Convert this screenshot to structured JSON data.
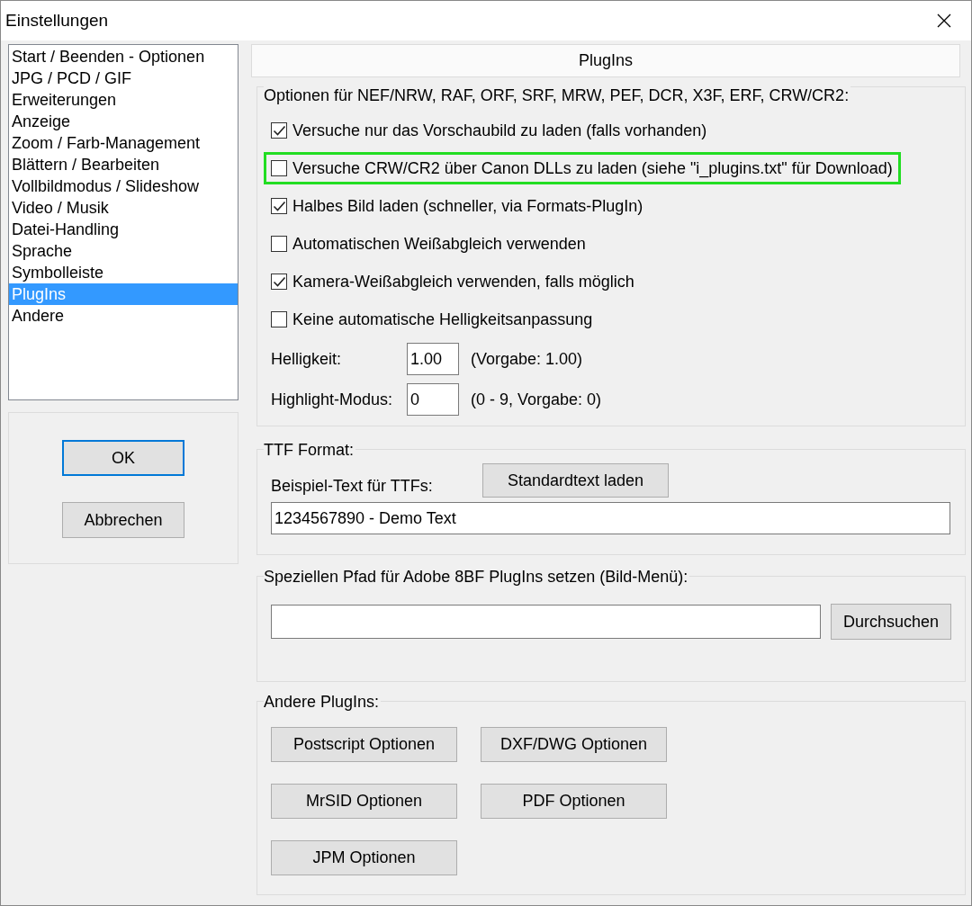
{
  "window": {
    "title": "Einstellungen"
  },
  "sidebar": {
    "items": [
      {
        "label": "Start / Beenden - Optionen",
        "selected": false
      },
      {
        "label": "JPG / PCD / GIF",
        "selected": false
      },
      {
        "label": "Erweiterungen",
        "selected": false
      },
      {
        "label": "Anzeige",
        "selected": false
      },
      {
        "label": "Zoom / Farb-Management",
        "selected": false
      },
      {
        "label": "Blättern / Bearbeiten",
        "selected": false
      },
      {
        "label": "Vollbildmodus / Slideshow",
        "selected": false
      },
      {
        "label": "Video / Musik",
        "selected": false
      },
      {
        "label": "Datei-Handling",
        "selected": false
      },
      {
        "label": "Sprache",
        "selected": false
      },
      {
        "label": "Symbolleiste",
        "selected": false
      },
      {
        "label": "PlugIns",
        "selected": true
      },
      {
        "label": "Andere",
        "selected": false
      }
    ]
  },
  "dialog_buttons": [
    {
      "label": "OK",
      "default": true
    },
    {
      "label": "Abbrechen",
      "default": false
    }
  ],
  "page_title": "PlugIns",
  "raw_group": {
    "title": "Optionen für NEF/NRW, RAF, ORF, SRF, MRW, PEF, DCR, X3F, ERF, CRW/CR2:",
    "options": [
      {
        "label": "Versuche nur das Vorschaubild zu laden (falls vorhanden)",
        "checked": true,
        "highlighted": false
      },
      {
        "label": "Versuche CRW/CR2 über Canon DLLs zu laden (siehe \"i_plugins.txt\" für Download)",
        "checked": false,
        "highlighted": true
      },
      {
        "label": "Halbes Bild laden (schneller, via Formats-PlugIn)",
        "checked": true,
        "highlighted": false
      },
      {
        "label": "Automatischen Weißabgleich verwenden",
        "checked": false,
        "highlighted": false
      },
      {
        "label": "Kamera-Weißabgleich verwenden, falls möglich",
        "checked": true,
        "highlighted": false
      },
      {
        "label": "Keine automatische Helligkeitsanpassung",
        "checked": false,
        "highlighted": false
      }
    ],
    "fields": [
      {
        "label": "Helligkeit:",
        "value": "1.00",
        "note": "(Vorgabe: 1.00)"
      },
      {
        "label": "Highlight-Modus:",
        "value": "0",
        "note": "(0 - 9, Vorgabe: 0)"
      }
    ]
  },
  "ttf_group": {
    "title": "TTF Format:",
    "label": "Beispiel-Text für TTFs:",
    "button": "Standardtext laden",
    "value": "1234567890 - Demo Text"
  },
  "path_group": {
    "title": "Speziellen Pfad für Adobe 8BF PlugIns setzen (Bild-Menü):",
    "button": "Durchsuchen"
  },
  "other_group": {
    "title": "Andere PlugIns:",
    "buttons": [
      "Postscript Optionen",
      "DXF/DWG Optionen",
      "MrSID Optionen",
      "PDF Optionen",
      "JPM Optionen"
    ]
  }
}
